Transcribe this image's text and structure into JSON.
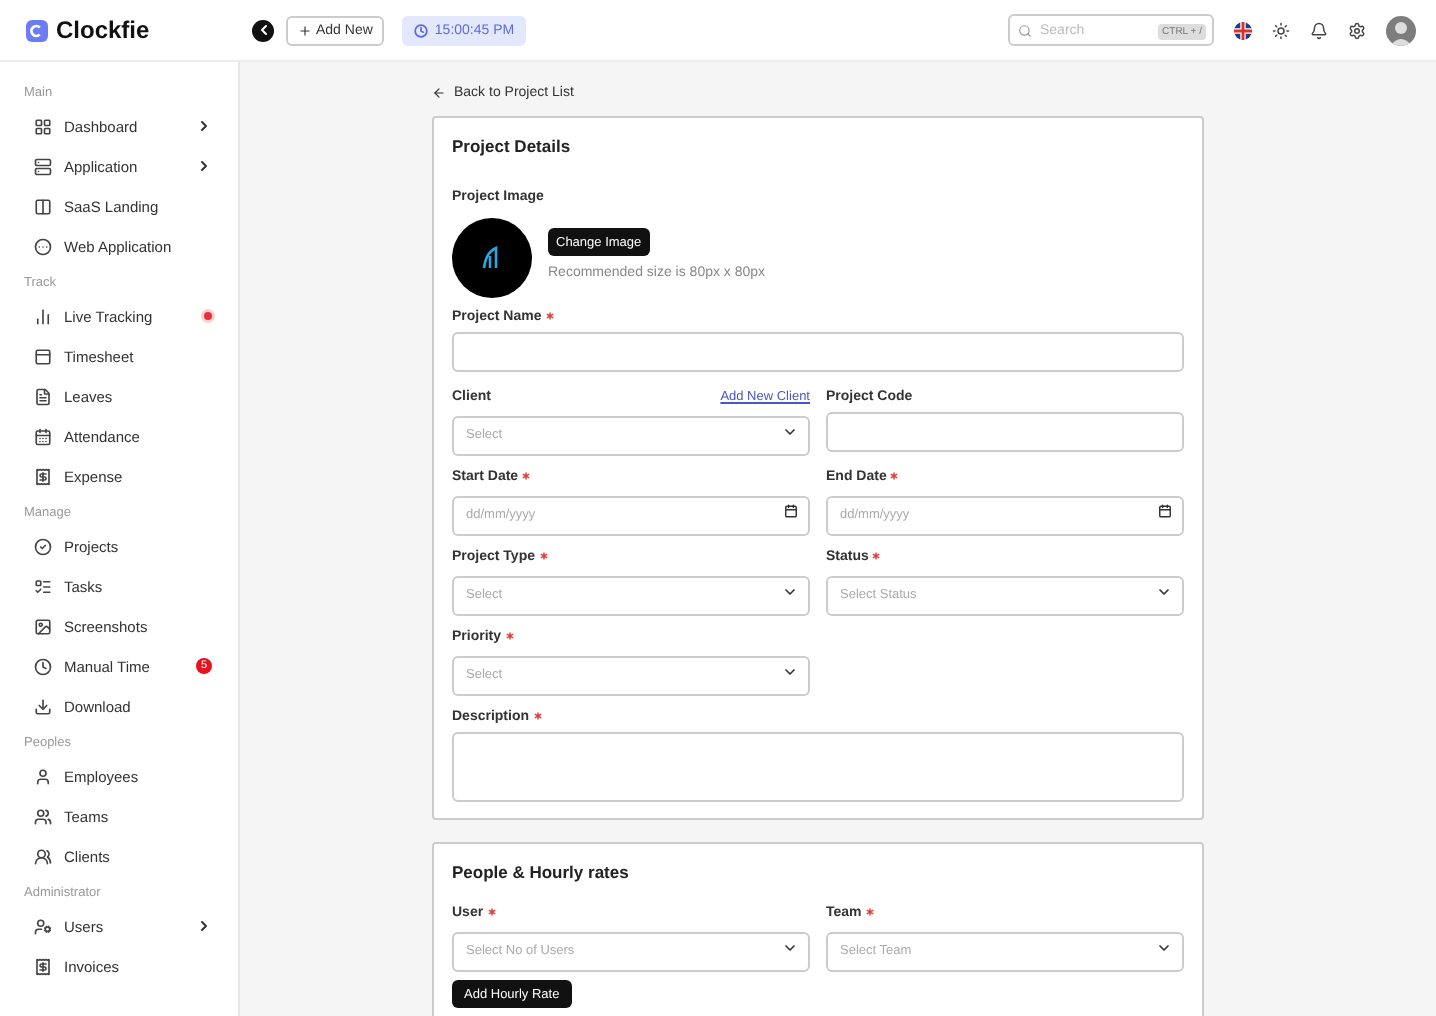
{
  "header": {
    "brand": "Clockfie",
    "add_button": "Add New",
    "clock": "15:00:45 PM",
    "search": {
      "placeholder": "Search",
      "shortcut": "CTRL + /"
    }
  },
  "sidebar": [
    {
      "title": "Main",
      "items": [
        {
          "label": "Dashboard",
          "expandable": true
        },
        {
          "label": "Application",
          "expandable": true
        },
        {
          "label": "SaaS Landing",
          "expandable": false
        },
        {
          "label": "Web Application",
          "expandable": false
        }
      ]
    },
    {
      "title": "Track",
      "items": [
        {
          "label": "Live Tracking",
          "expandable": false,
          "live": true
        },
        {
          "label": "Timesheet",
          "expandable": false
        },
        {
          "label": "Leaves",
          "expandable": false
        },
        {
          "label": "Attendance",
          "expandable": false
        },
        {
          "label": "Expense",
          "expandable": false
        }
      ]
    },
    {
      "title": "Manage",
      "items": [
        {
          "label": "Projects",
          "expandable": false
        },
        {
          "label": "Tasks",
          "expandable": false
        },
        {
          "label": "Screenshots",
          "expandable": false
        },
        {
          "label": "Manual Time",
          "expandable": false,
          "badge": "5"
        },
        {
          "label": "Download",
          "expandable": false
        }
      ]
    },
    {
      "title": "Peoples",
      "items": [
        {
          "label": "Employees",
          "expandable": false
        },
        {
          "label": "Teams",
          "expandable": false
        },
        {
          "label": "Clients",
          "expandable": false
        }
      ]
    },
    {
      "title": "Administrator",
      "items": [
        {
          "label": "Users",
          "expandable": true
        },
        {
          "label": "Invoices",
          "expandable": false
        }
      ]
    }
  ],
  "back_link": "Back to Project List",
  "details": {
    "title": "Project Details",
    "image_label": "Project Image",
    "change_button": "Change Image",
    "image_hint": "Recommended size is 80px x 80px",
    "fields": [
      {
        "kind": "text",
        "label": "Project Name",
        "required": true,
        "wide": true
      },
      {
        "kind": "select",
        "label": "Client",
        "required": false,
        "placeholder": "Select",
        "link": "Add New Client"
      },
      {
        "kind": "text",
        "label": "Project Code",
        "required": false
      },
      {
        "kind": "date",
        "label": "Start Date",
        "required": true,
        "placeholder": "dd/mm/yyyy"
      },
      {
        "kind": "date",
        "label": "End Date",
        "required": true,
        "placeholder": "dd/mm/yyyy"
      },
      {
        "kind": "select",
        "label": "Project Type",
        "required": true,
        "placeholder": "Select"
      },
      {
        "kind": "select",
        "label": "Status",
        "required": true,
        "placeholder": "Select Status"
      },
      {
        "kind": "select",
        "label": "Priority",
        "required": true,
        "placeholder": "Select"
      },
      {
        "kind": "textarea",
        "label": "Description",
        "required": true,
        "wide": true
      }
    ]
  },
  "people": {
    "title": "People & Hourly rates",
    "fields": [
      {
        "kind": "select",
        "label": "User",
        "required": true,
        "placeholder": "Select No of Users"
      },
      {
        "kind": "select",
        "label": "Team",
        "required": true,
        "placeholder": "Select Team"
      }
    ],
    "button": "Add Hourly Rate"
  }
}
